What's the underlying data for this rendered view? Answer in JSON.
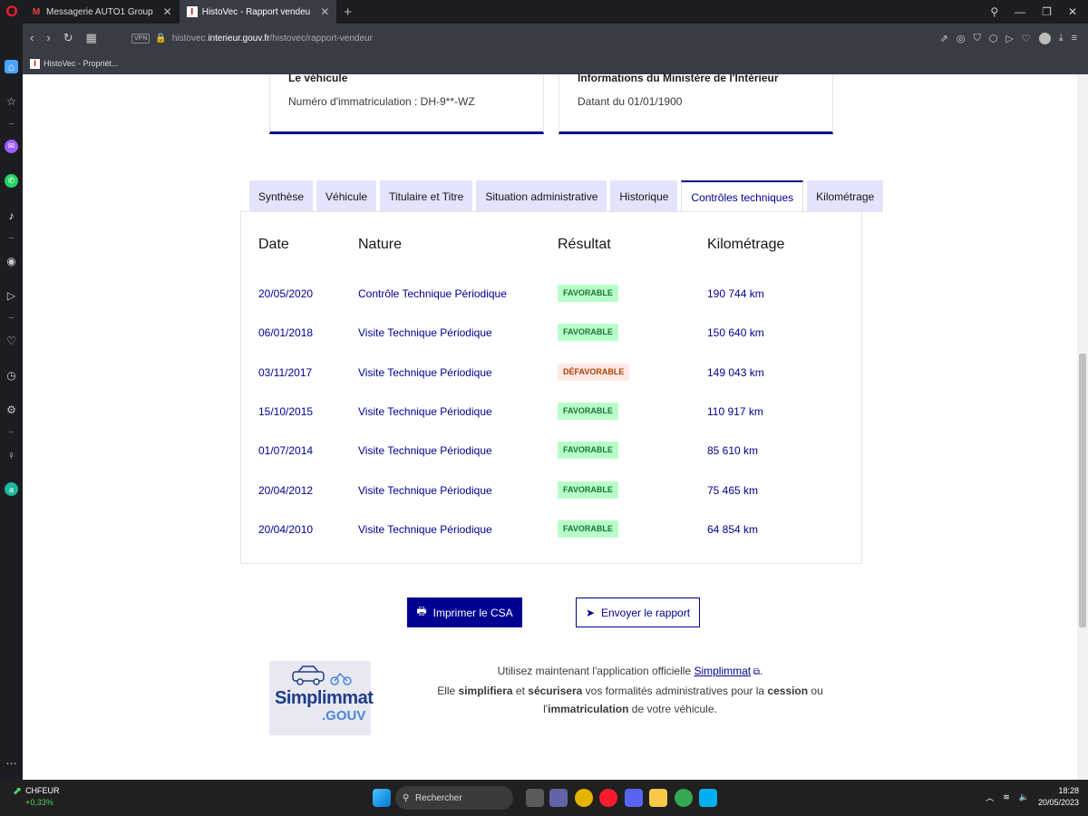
{
  "browser": {
    "tabs": [
      {
        "label": "Messagerie AUTO1 Group",
        "icon": "gmail-icon"
      },
      {
        "label": "HistoVec - Rapport vendeu",
        "icon": "histovec-icon"
      }
    ],
    "url_prefix": "histovec.",
    "url_domain": "interieur.gouv.fr",
    "url_path": "/histovec/rapport-vendeur",
    "vpn_label": "VPN",
    "bookmark": "HistoVec - Propriét..."
  },
  "cards": [
    {
      "title": "Le véhicule",
      "text": "Numéro d'immatriculation : DH-9**-WZ"
    },
    {
      "title": "Informations du Ministère de l'Intérieur",
      "text": "Datant du 01/01/1900"
    }
  ],
  "tabs": [
    {
      "label": "Synthèse"
    },
    {
      "label": "Véhicule"
    },
    {
      "label": "Titulaire et Titre"
    },
    {
      "label": "Situation administrative"
    },
    {
      "label": "Historique"
    },
    {
      "label": "Contrôles techniques"
    },
    {
      "label": "Kilométrage"
    }
  ],
  "table": {
    "headers": [
      "Date",
      "Nature",
      "Résultat",
      "Kilométrage"
    ],
    "rows": [
      {
        "date": "20/05/2020",
        "nature": "Contrôle Technique Périodique",
        "result": "FAVORABLE",
        "km": "190 744 km"
      },
      {
        "date": "06/01/2018",
        "nature": "Visite Technique Périodique",
        "result": "FAVORABLE",
        "km": "150 640 km"
      },
      {
        "date": "03/11/2017",
        "nature": "Visite Technique Périodique",
        "result": "DÉFAVORABLE",
        "km": "149 043 km"
      },
      {
        "date": "15/10/2015",
        "nature": "Visite Technique Périodique",
        "result": "FAVORABLE",
        "km": "110 917 km"
      },
      {
        "date": "01/07/2014",
        "nature": "Visite Technique Périodique",
        "result": "FAVORABLE",
        "km": "85 610 km"
      },
      {
        "date": "20/04/2012",
        "nature": "Visite Technique Périodique",
        "result": "FAVORABLE",
        "km": "75 465 km"
      },
      {
        "date": "20/04/2010",
        "nature": "Visite Technique Périodique",
        "result": "FAVORABLE",
        "km": "64 854 km"
      }
    ]
  },
  "actions": {
    "print": "Imprimer le CSA",
    "send": "Envoyer le rapport"
  },
  "promo": {
    "logo_main": "Simplimmat",
    "logo_sub": ".GOUV",
    "line1_before": "Utilisez maintenant l'application officielle ",
    "line1_link": "Simplimmat",
    "line1_after": ".",
    "line2_a": "Elle ",
    "line2_b": "simplifiera",
    "line2_c": " et ",
    "line2_d": "sécurisera",
    "line2_e": " vos formalités administratives pour la ",
    "line2_f": "cession",
    "line2_g": " ou l'",
    "line2_h": "immatriculation",
    "line2_i": " de votre véhicule."
  },
  "taskbar": {
    "stock_name": "CHFEUR",
    "stock_change": "+0,33%",
    "search": "Rechercher",
    "time": "18:28",
    "date": "20/05/2023"
  },
  "colors": {
    "primary": "#000091",
    "favorable_bg": "#b8fec9",
    "favorable_text": "#18753c",
    "defavorable_bg": "#ffe9e6",
    "defavorable_text": "#b34000"
  }
}
